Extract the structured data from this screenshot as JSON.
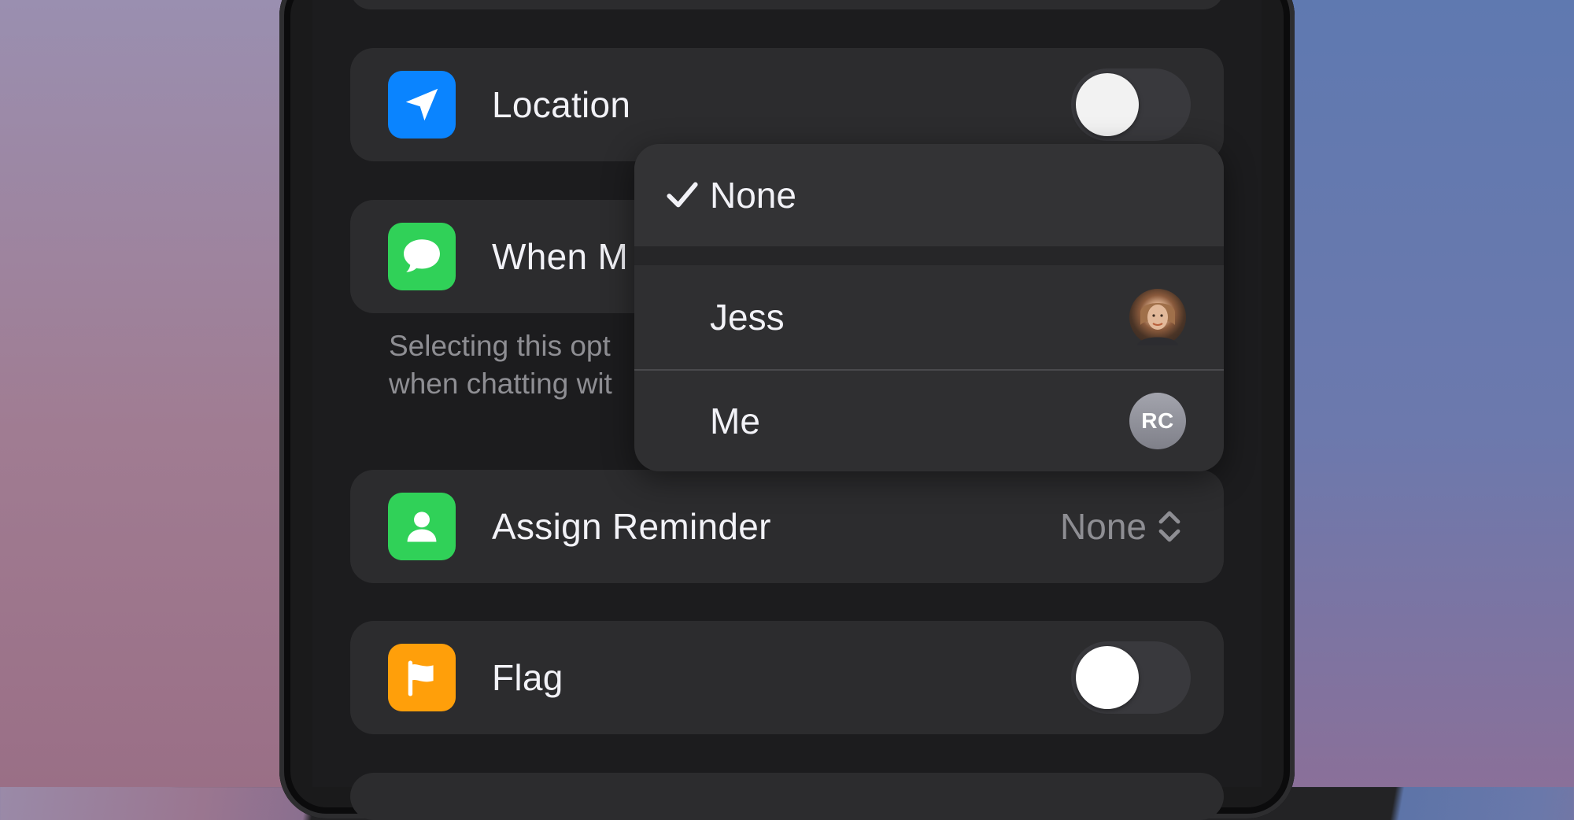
{
  "rows": {
    "location": {
      "label": "Location",
      "icon": "location-arrow-icon",
      "color": "#0a84ff",
      "toggle_on": false
    },
    "messaging": {
      "label": "When M",
      "icon": "message-bubble-icon",
      "color": "#30d158"
    },
    "footnote": {
      "line1": "Selecting this opt",
      "line2": "when chatting wit"
    },
    "assign": {
      "label": "Assign Reminder",
      "value": "None",
      "icon": "person-icon",
      "color": "#30d158"
    },
    "flag": {
      "label": "Flag",
      "icon": "flag-icon",
      "color": "#ff9f0a",
      "toggle_on": false
    }
  },
  "menu": {
    "items": [
      {
        "label": "None",
        "checked": true
      },
      {
        "label": "Jess",
        "avatar": "photo"
      },
      {
        "label": "Me",
        "avatar_initials": "RC"
      }
    ]
  }
}
